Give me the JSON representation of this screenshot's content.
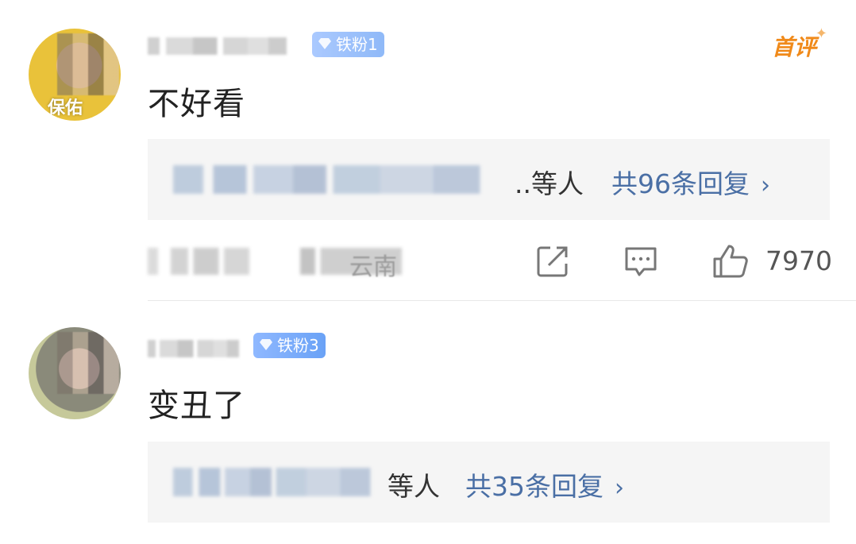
{
  "comments": [
    {
      "avatar_tag": "保佑",
      "fan_badge": "铁粉1",
      "first_comment_badge": "首评",
      "text": "不好看",
      "reply_suffix": "..等人",
      "reply_count_label": "共96条回复",
      "meta_location": "云南",
      "like_count": "7970"
    },
    {
      "fan_badge": "铁粉3",
      "text": "变丑了",
      "reply_suffix": "等人",
      "reply_count_label": "共35条回复"
    }
  ],
  "icons": {
    "share": "share-icon",
    "reply": "comment-icon",
    "like": "thumbs-up-icon",
    "fan": "diamond-icon",
    "chevron": "chevron-right-icon"
  },
  "colors": {
    "accent_link": "#4a6fa5",
    "badge_blue": "#6aa2f6",
    "first_comment_orange": "#f08a1a",
    "reply_bg": "#f5f5f5"
  },
  "chevron": "›"
}
